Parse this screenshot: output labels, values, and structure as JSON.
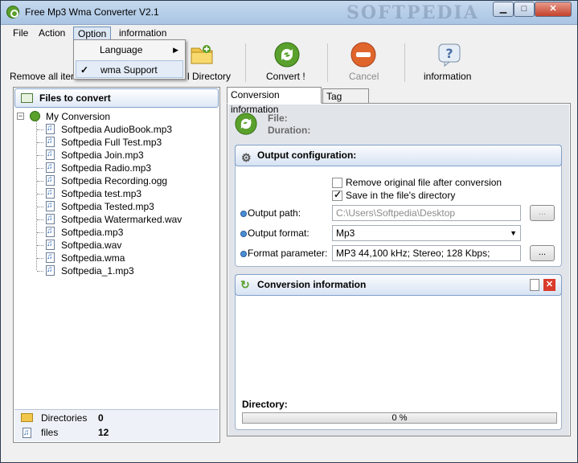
{
  "window": {
    "title": "Free Mp3 Wma Converter V2.1",
    "watermark": "SOFTPEDIA"
  },
  "menubar": {
    "file": "File",
    "action": "Action",
    "option": "Option",
    "information": "information"
  },
  "option_menu": {
    "language": "Language",
    "language_arrow": "▶",
    "wma_support": "wma Support",
    "wma_support_check": "✓"
  },
  "toolbar": {
    "remove_all": "Remove all iter",
    "add_directory": "l Directory",
    "convert": "Convert !",
    "cancel": "Cancel",
    "information": "information"
  },
  "files_panel": {
    "title": "Files to convert",
    "root": "My Conversion",
    "files": [
      "Softpedia AudioBook.mp3",
      "Softpedia Full Test.mp3",
      "Softpedia Join.mp3",
      "Softpedia Radio.mp3",
      "Softpedia Recording.ogg",
      "Softpedia test.mp3",
      "Softpedia Tested.mp3",
      "Softpedia Watermarked.wav",
      "Softpedia.mp3",
      "Softpedia.wav",
      "Softpedia.wma",
      "Softpedia_1.mp3"
    ],
    "stats": {
      "directories_label": "Directories",
      "directories_value": "0",
      "files_label": "files",
      "files_value": "12"
    }
  },
  "tabs": {
    "conversion_info": "Conversion information",
    "tag_editor": "Tag Editor"
  },
  "file_info": {
    "file_label": "File:",
    "duration_label": "Duration:"
  },
  "output_config": {
    "title": "Output configuration:",
    "remove_original": "Remove original file after conversion",
    "remove_original_checked": false,
    "save_in_dir": "Save in the file's directory",
    "save_in_dir_checked": true,
    "output_path_label": "Output path:",
    "output_path_value": "C:\\Users\\Softpedia\\Desktop",
    "output_format_label": "Output format:",
    "output_format_value": "Mp3",
    "format_param_label": "Format parameter:",
    "format_param_value": "MP3 44,100 kHz; Stereo;  128 Kbps;",
    "browse_label": "...",
    "param_button_label": "..."
  },
  "conversion_info": {
    "title": "Conversion information",
    "directory_label": "Directory:",
    "progress_text": "0 %",
    "progress": 0
  },
  "colors": {
    "accent": "#7fa0c8",
    "convert_green": "#5aa02c",
    "cancel_red": "#e0652c"
  }
}
